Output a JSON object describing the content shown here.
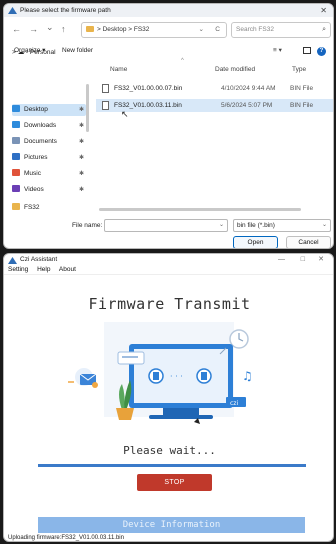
{
  "file_dialog": {
    "title": "Please select the firmware path",
    "close_glyph": "✕",
    "nav": {
      "back": "←",
      "forward": "→",
      "recent": "⌄",
      "up": "↑"
    },
    "breadcrumb": "> Desktop > FS32",
    "path_dropdown": "⌄",
    "refresh": "C",
    "search_placeholder": "Search FS32",
    "toolbar": {
      "organize": "Organize ▾",
      "new_folder": "New folder",
      "view": "≡ ▾",
      "help": "?"
    },
    "sidebar": {
      "personal": "> ☁ - Personal",
      "items": [
        {
          "label": "Desktop",
          "icon": "desktop-icon",
          "color": "#2e8bdc",
          "selected": true
        },
        {
          "label": "Downloads",
          "icon": "download-icon",
          "color": "#2e8bdc",
          "selected": false
        },
        {
          "label": "Documents",
          "icon": "documents-icon",
          "color": "#7a93b6",
          "selected": false
        },
        {
          "label": "Pictures",
          "icon": "pictures-icon",
          "color": "#2e6fc4",
          "selected": false
        },
        {
          "label": "Music",
          "icon": "music-icon",
          "color": "#e0533a",
          "selected": false
        },
        {
          "label": "Videos",
          "icon": "videos-icon",
          "color": "#6b3fb5",
          "selected": false
        },
        {
          "label": "FS32",
          "icon": "folder-icon",
          "color": "#e9b44c",
          "selected": false
        }
      ],
      "pin_glyph": "✱"
    },
    "columns": {
      "name": "Name",
      "date": "Date modified",
      "type": "Type"
    },
    "files": [
      {
        "name": "FS32_V01.00.00.07.bin",
        "date": "4/10/2024 9:44 AM",
        "type": "BIN File",
        "selected": false
      },
      {
        "name": "FS32_V01.00.03.11.bin",
        "date": "5/6/2024 5:07 PM",
        "type": "BIN File",
        "selected": true
      }
    ],
    "filename_label": "File name:",
    "filename_value": "",
    "filetype_value": "bin file (*.bin)",
    "open_button": "Open",
    "cancel_button": "Cancel"
  },
  "app": {
    "title": "Czi Assistant",
    "window_controls": {
      "minimize": "—",
      "maximize": "□",
      "close": "✕"
    },
    "menu": [
      "Setting",
      "Help",
      "About"
    ],
    "heading": "Firmware Transmit",
    "wait_text": "Please wait...",
    "progress": 1.0,
    "stop_button": "STOP",
    "device_info_button": "Device Information",
    "status_text": "Uploading firmware:FS32_V01.00.03.11.bin",
    "colors": {
      "accent": "#3b7ac9",
      "stop": "#c0392b",
      "device_info": "#8ab6e8"
    }
  }
}
